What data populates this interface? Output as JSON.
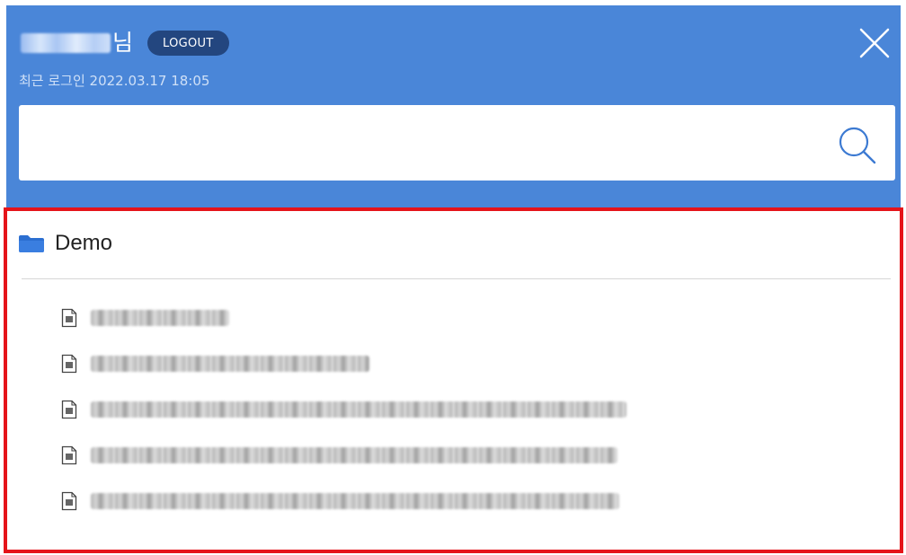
{
  "header": {
    "user_suffix": "님",
    "logout_label": "LOGOUT",
    "last_login": "최근 로그인 2022.03.17 18:05",
    "close_icon": "close-icon"
  },
  "search": {
    "value": "",
    "placeholder": "",
    "icon": "search-icon"
  },
  "tree": {
    "folder": {
      "label": "Demo",
      "icon": "folder-icon"
    },
    "documents": [
      {
        "title": "",
        "icon": "document-icon"
      },
      {
        "title": "",
        "icon": "document-icon"
      },
      {
        "title": "",
        "icon": "document-icon"
      },
      {
        "title": "",
        "icon": "document-icon"
      },
      {
        "title": "",
        "icon": "document-icon"
      }
    ]
  },
  "colors": {
    "header_bg": "#4a86d8",
    "logout_bg": "#23467f",
    "highlight_border": "#e5141a",
    "folder_icon": "#2c6fd1"
  }
}
